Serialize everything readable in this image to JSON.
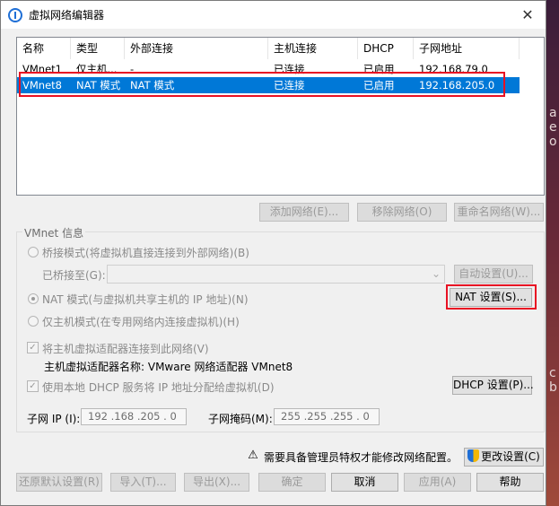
{
  "window": {
    "title": "虚拟网络编辑器",
    "close": "✕"
  },
  "table": {
    "headers": [
      "名称",
      "类型",
      "外部连接",
      "主机连接",
      "DHCP",
      "子网地址"
    ],
    "rows": [
      [
        "VMnet1",
        "仅主机...",
        "-",
        "已连接",
        "已启用",
        "192.168.79.0"
      ],
      [
        "VMnet8",
        "NAT 模式",
        "NAT 模式",
        "已连接",
        "已启用",
        "192.168.205.0"
      ]
    ]
  },
  "list_buttons": {
    "add": "添加网络(E)...",
    "remove": "移除网络(O)",
    "rename": "重命名网络(W)..."
  },
  "vmnet_info": {
    "title": "VMnet 信息",
    "bridge_radio": "桥接模式(将虚拟机直接连接到外部网络)(B)",
    "bridged_to_label": "已桥接至(G):",
    "bridged_to_value": "",
    "auto_settings": "自动设置(U)...",
    "nat_radio": "NAT 模式(与虚拟机共享主机的 IP 地址)(N)",
    "nat_settings": "NAT 设置(S)...",
    "host_only_radio": "仅主机模式(在专用网络内连接虚拟机)(H)",
    "connect_adapter_check": "将主机虚拟适配器连接到此网络(V)",
    "adapter_name": "主机虚拟适配器名称: VMware 网络适配器 VMnet8",
    "dhcp_check": "使用本地 DHCP 服务将 IP 地址分配给虚拟机(D)",
    "dhcp_settings": "DHCP 设置(P)...",
    "subnet_ip_label": "子网 IP (I):",
    "subnet_ip_value": "192 .168 .205 . 0",
    "subnet_mask_label": "子网掩码(M):",
    "subnet_mask_value": "255 .255 .255 . 0"
  },
  "warning": {
    "text": "需要具备管理员特权才能修改网络配置。",
    "change_settings": "更改设置(C)"
  },
  "footer": {
    "restore": "还原默认设置(R)",
    "import": "导入(T)...",
    "export": "导出(X)...",
    "ok": "确定",
    "cancel": "取消",
    "apply": "应用(A)",
    "help": "帮助"
  },
  "background": {
    "glyphs": [
      "a",
      "e",
      "o",
      "c",
      "b"
    ]
  },
  "colors": {
    "selection": "#0078d7",
    "highlight_box": "#e81123"
  }
}
